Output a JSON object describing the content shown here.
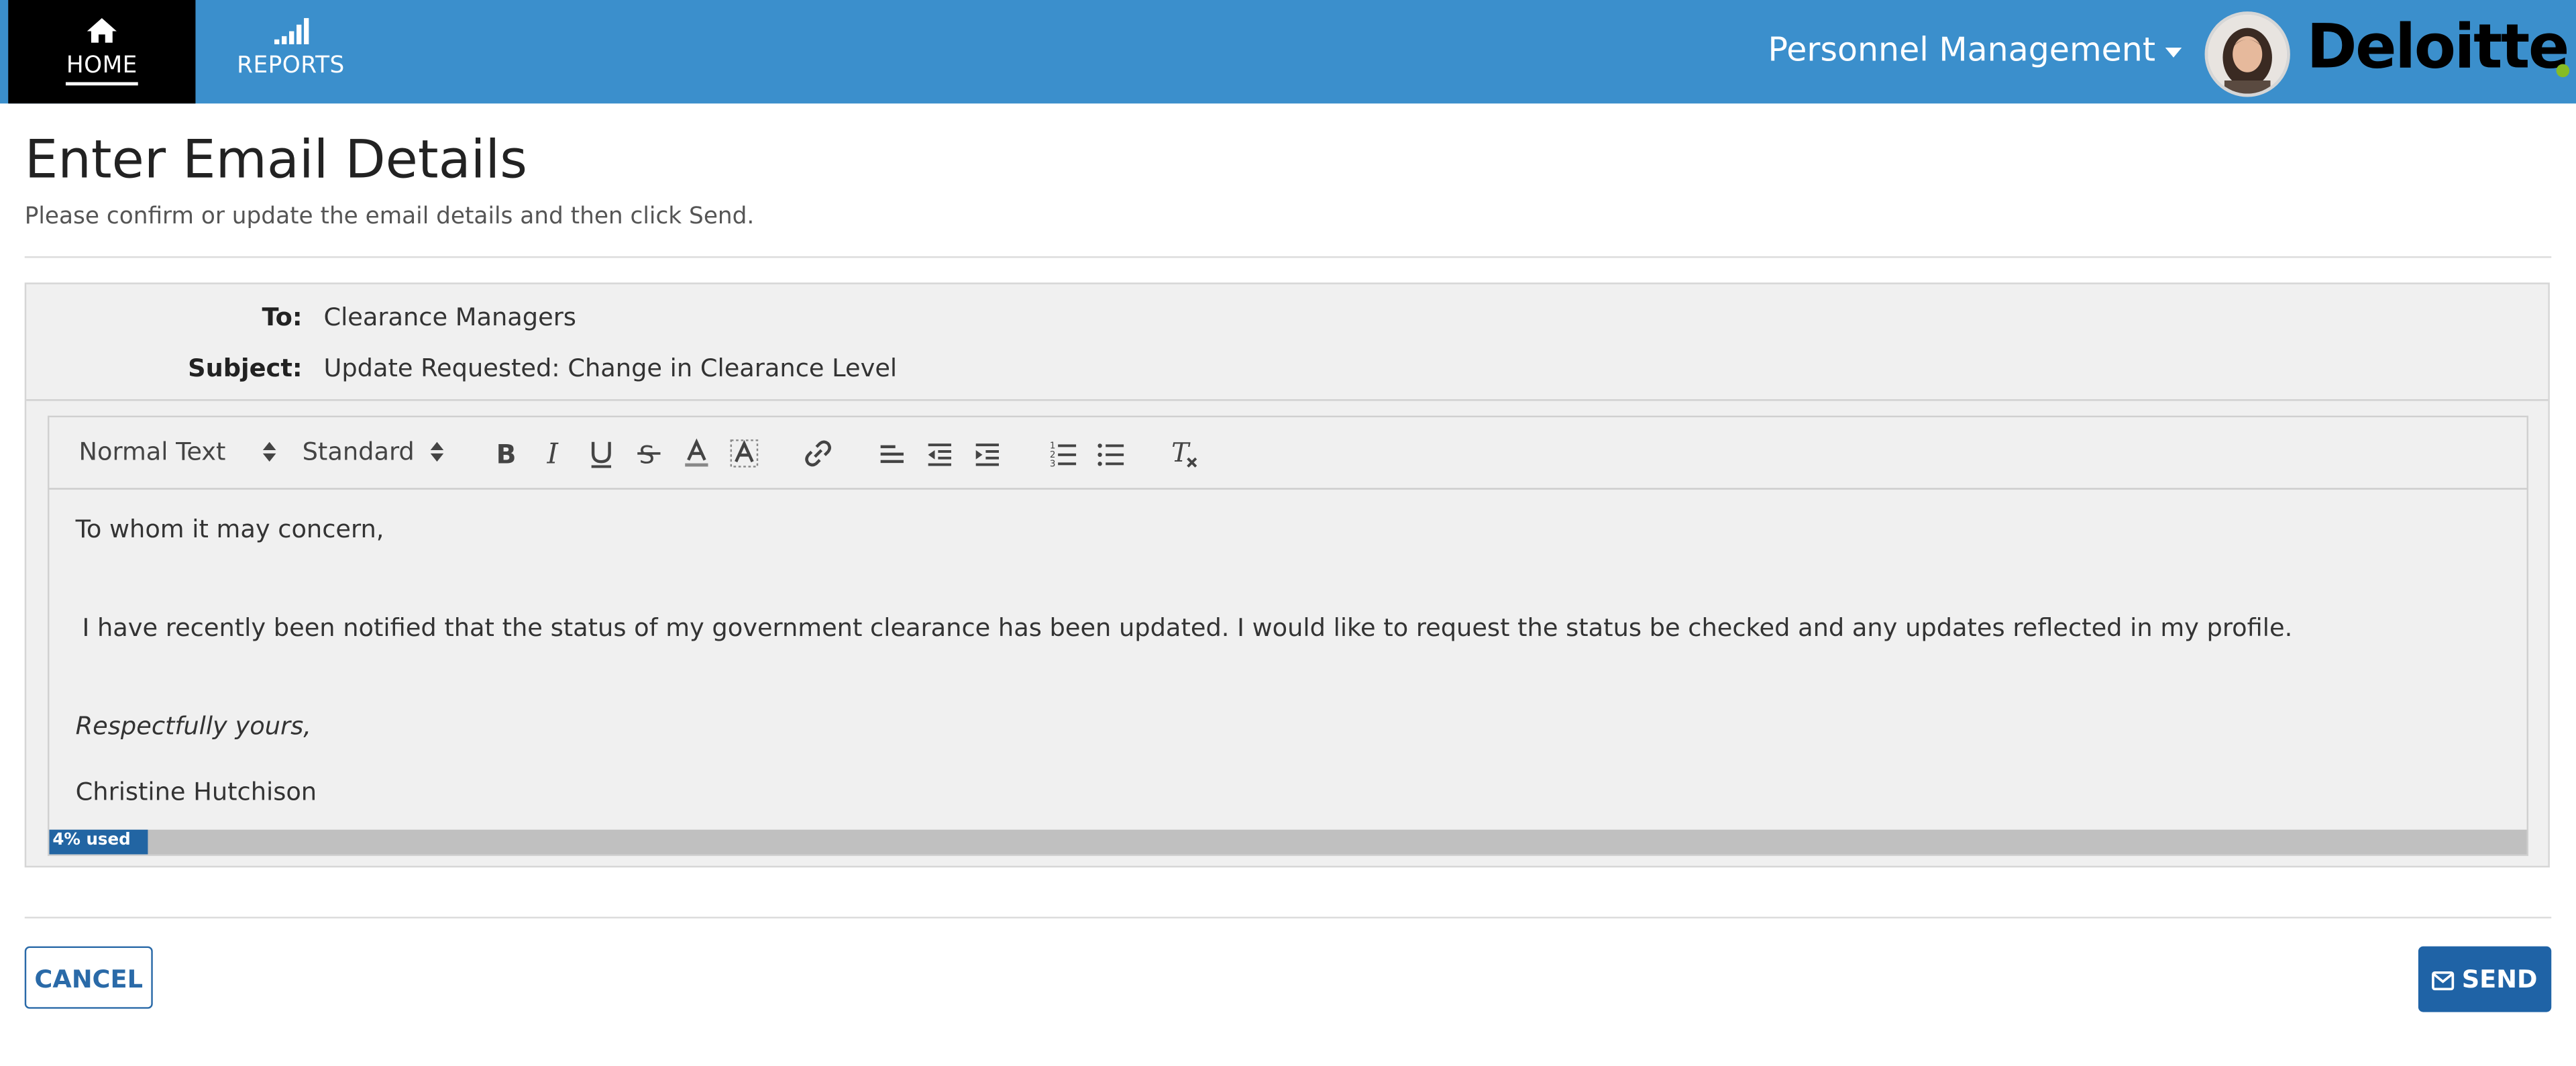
{
  "nav": {
    "tabs": [
      {
        "label": "HOME",
        "icon": "home-icon",
        "active": true
      },
      {
        "label": "REPORTS",
        "icon": "signal-bars-icon",
        "active": false
      }
    ],
    "app_switcher": "Personnel Management",
    "brand": "Deloitte",
    "brand_accent": "#86bc25",
    "bar_color": "#3b8fcc"
  },
  "page": {
    "title": "Enter Email Details",
    "subtitle": "Please confirm or update the email details and then click Send."
  },
  "email": {
    "to_label": "To:",
    "to_value": "Clearance Managers",
    "subject_label": "Subject:",
    "subject_value": "Update Requested: Change in Clearance Level"
  },
  "toolbar": {
    "format_select": "Normal Text",
    "font_select": "Standard",
    "buttons": [
      "bold-icon",
      "italic-icon",
      "underline-icon",
      "strikethrough-icon",
      "text-color-icon",
      "highlight-icon",
      "link-icon",
      "align-left-icon",
      "outdent-icon",
      "indent-icon",
      "ordered-list-icon",
      "bullet-list-icon",
      "clear-format-icon"
    ]
  },
  "body": {
    "greeting": "To whom it may concern,",
    "paragraph": "I have recently been notified that the status of my government clearance has been updated. I would like to request the status be checked and any updates reflected in my profile.",
    "closing": "Respectfully yours,",
    "signature": "Christine Hutchison"
  },
  "usage": {
    "label": "4% used",
    "percent": 4
  },
  "actions": {
    "cancel_label": "CANCEL",
    "send_label": "SEND"
  }
}
